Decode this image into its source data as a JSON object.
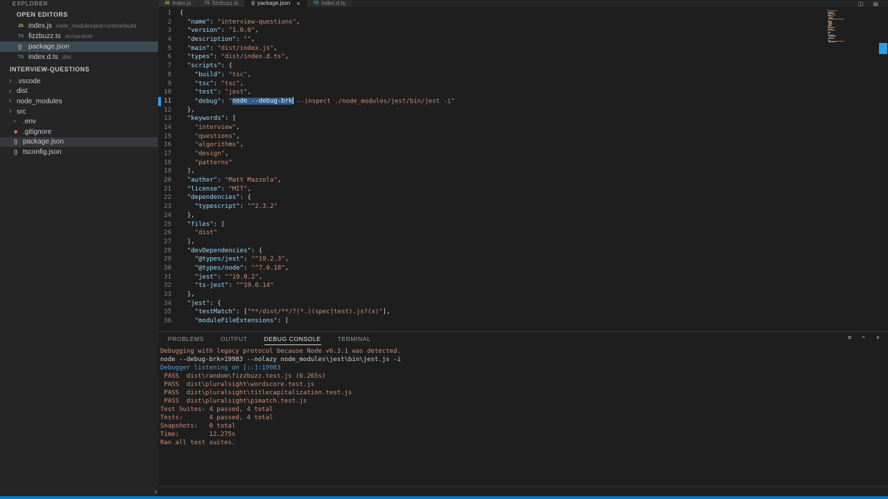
{
  "sidebar": {
    "title": "EXPLORER",
    "open_editors": {
      "title": "OPEN EDITORS",
      "items": [
        {
          "icon": "js",
          "name": "index.js",
          "path": "node_modules\\jest-runtime\\build",
          "selected": false
        },
        {
          "icon": "ts",
          "name": "fizzbuzz.ts",
          "path": "src\\random",
          "selected": false
        },
        {
          "icon": "json",
          "name": "package.json",
          "path": "",
          "selected": true
        },
        {
          "icon": "ts",
          "name": "index.d.ts",
          "path": "dist",
          "selected": false
        }
      ]
    },
    "tree": {
      "title": "INTERVIEW-QUESTIONS",
      "items": [
        {
          "kind": "folder",
          "name": ".vscode"
        },
        {
          "kind": "folder",
          "name": "dist"
        },
        {
          "kind": "folder",
          "name": "node_modules"
        },
        {
          "kind": "folder",
          "name": "src"
        },
        {
          "kind": "file",
          "icon": "env",
          "name": ".env"
        },
        {
          "kind": "file",
          "icon": "git",
          "name": ".gitignore"
        },
        {
          "kind": "file",
          "icon": "json",
          "name": "package.json",
          "selected": true
        },
        {
          "kind": "file",
          "icon": "json",
          "name": "tsconfig.json"
        }
      ]
    }
  },
  "tabs": [
    {
      "icon": "js",
      "label": "index.js",
      "active": false
    },
    {
      "icon": "ts",
      "label": "fizzbuzz.ts",
      "active": false
    },
    {
      "icon": "json",
      "label": "package.json",
      "active": true,
      "close": "×"
    },
    {
      "icon": "ts",
      "label": "index.d.ts",
      "active": false
    }
  ],
  "tabbar_actions": {
    "split_icon": "◫",
    "layout_icon": "▤"
  },
  "editor": {
    "selection_line": 11,
    "lines": [
      {
        "n": 1,
        "tokens": [
          [
            "p",
            "{"
          ]
        ]
      },
      {
        "n": 2,
        "tokens": [
          [
            "p",
            "  "
          ],
          [
            "k",
            "\"name\""
          ],
          [
            "p",
            ": "
          ],
          [
            "s",
            "\"interview-questions\""
          ],
          [
            "p",
            ","
          ]
        ]
      },
      {
        "n": 3,
        "tokens": [
          [
            "p",
            "  "
          ],
          [
            "k",
            "\"version\""
          ],
          [
            "p",
            ": "
          ],
          [
            "s",
            "\"1.0.0\""
          ],
          [
            "p",
            ","
          ]
        ]
      },
      {
        "n": 4,
        "tokens": [
          [
            "p",
            "  "
          ],
          [
            "k",
            "\"description\""
          ],
          [
            "p",
            ": "
          ],
          [
            "s",
            "\"\""
          ],
          [
            "p",
            ","
          ]
        ]
      },
      {
        "n": 5,
        "tokens": [
          [
            "p",
            "  "
          ],
          [
            "k",
            "\"main\""
          ],
          [
            "p",
            ": "
          ],
          [
            "s",
            "\"dist/index.js\""
          ],
          [
            "p",
            ","
          ]
        ]
      },
      {
        "n": 6,
        "tokens": [
          [
            "p",
            "  "
          ],
          [
            "k",
            "\"types\""
          ],
          [
            "p",
            ": "
          ],
          [
            "s",
            "\"dist/index.d.ts\""
          ],
          [
            "p",
            ","
          ]
        ]
      },
      {
        "n": 7,
        "tokens": [
          [
            "p",
            "  "
          ],
          [
            "k",
            "\"scripts\""
          ],
          [
            "p",
            ": {"
          ]
        ]
      },
      {
        "n": 8,
        "tokens": [
          [
            "p",
            "    "
          ],
          [
            "k",
            "\"build\""
          ],
          [
            "p",
            ": "
          ],
          [
            "s",
            "\"tsc\""
          ],
          [
            "p",
            ","
          ]
        ]
      },
      {
        "n": 9,
        "tokens": [
          [
            "p",
            "    "
          ],
          [
            "k",
            "\"tsc\""
          ],
          [
            "p",
            ": "
          ],
          [
            "s",
            "\"tsc\""
          ],
          [
            "p",
            ","
          ]
        ]
      },
      {
        "n": 10,
        "tokens": [
          [
            "p",
            "    "
          ],
          [
            "k",
            "\"test\""
          ],
          [
            "p",
            ": "
          ],
          [
            "s",
            "\"jest\""
          ],
          [
            "p",
            ","
          ]
        ]
      },
      {
        "n": 11,
        "tokens": [
          [
            "p",
            "    "
          ],
          [
            "k",
            "\"debug\""
          ],
          [
            "p",
            ": "
          ],
          [
            "s",
            "\""
          ],
          [
            "sel",
            "node --debug-brk"
          ],
          [
            "cur",
            ""
          ],
          [
            "s",
            " --inspect ./node_modules/jest/bin/jest -i\""
          ]
        ]
      },
      {
        "n": 12,
        "tokens": [
          [
            "p",
            "  },"
          ]
        ]
      },
      {
        "n": 13,
        "tokens": [
          [
            "p",
            "  "
          ],
          [
            "k",
            "\"keywords\""
          ],
          [
            "p",
            ": ["
          ]
        ]
      },
      {
        "n": 14,
        "tokens": [
          [
            "p",
            "    "
          ],
          [
            "s",
            "\"interview\""
          ],
          [
            "p",
            ","
          ]
        ]
      },
      {
        "n": 15,
        "tokens": [
          [
            "p",
            "    "
          ],
          [
            "s",
            "\"questions\""
          ],
          [
            "p",
            ","
          ]
        ]
      },
      {
        "n": 16,
        "tokens": [
          [
            "p",
            "    "
          ],
          [
            "s",
            "\"algorithms\""
          ],
          [
            "p",
            ","
          ]
        ]
      },
      {
        "n": 17,
        "tokens": [
          [
            "p",
            "    "
          ],
          [
            "s",
            "\"design\""
          ],
          [
            "p",
            ","
          ]
        ]
      },
      {
        "n": 18,
        "tokens": [
          [
            "p",
            "    "
          ],
          [
            "s",
            "\"patterns\""
          ]
        ]
      },
      {
        "n": 19,
        "tokens": [
          [
            "p",
            "  ],"
          ]
        ]
      },
      {
        "n": 20,
        "tokens": [
          [
            "p",
            "  "
          ],
          [
            "k",
            "\"author\""
          ],
          [
            "p",
            ": "
          ],
          [
            "s",
            "\"Matt Mazzola\""
          ],
          [
            "p",
            ","
          ]
        ]
      },
      {
        "n": 21,
        "tokens": [
          [
            "p",
            "  "
          ],
          [
            "k",
            "\"license\""
          ],
          [
            "p",
            ": "
          ],
          [
            "s",
            "\"MIT\""
          ],
          [
            "p",
            ","
          ]
        ]
      },
      {
        "n": 22,
        "tokens": [
          [
            "p",
            "  "
          ],
          [
            "k",
            "\"dependencies\""
          ],
          [
            "p",
            ": {"
          ]
        ]
      },
      {
        "n": 23,
        "tokens": [
          [
            "p",
            "    "
          ],
          [
            "k",
            "\"typescript\""
          ],
          [
            "p",
            ": "
          ],
          [
            "s",
            "\"^2.3.2\""
          ]
        ]
      },
      {
        "n": 24,
        "tokens": [
          [
            "p",
            "  },"
          ]
        ]
      },
      {
        "n": 25,
        "tokens": [
          [
            "p",
            "  "
          ],
          [
            "k",
            "\"files\""
          ],
          [
            "p",
            ": ["
          ]
        ]
      },
      {
        "n": 26,
        "tokens": [
          [
            "p",
            "    "
          ],
          [
            "s",
            "\"dist\""
          ]
        ]
      },
      {
        "n": 27,
        "tokens": [
          [
            "p",
            "  ],"
          ]
        ]
      },
      {
        "n": 28,
        "tokens": [
          [
            "p",
            "  "
          ],
          [
            "k",
            "\"devDependencies\""
          ],
          [
            "p",
            ": {"
          ]
        ]
      },
      {
        "n": 29,
        "tokens": [
          [
            "p",
            "    "
          ],
          [
            "k",
            "\"@types/jest\""
          ],
          [
            "p",
            ": "
          ],
          [
            "s",
            "\"^19.2.3\""
          ],
          [
            "p",
            ","
          ]
        ]
      },
      {
        "n": 30,
        "tokens": [
          [
            "p",
            "    "
          ],
          [
            "k",
            "\"@types/node\""
          ],
          [
            "p",
            ": "
          ],
          [
            "s",
            "\"^7.0.18\""
          ],
          [
            "p",
            ","
          ]
        ]
      },
      {
        "n": 31,
        "tokens": [
          [
            "p",
            "    "
          ],
          [
            "k",
            "\"jest\""
          ],
          [
            "p",
            ": "
          ],
          [
            "s",
            "\"^19.0.2\""
          ],
          [
            "p",
            ","
          ]
        ]
      },
      {
        "n": 32,
        "tokens": [
          [
            "p",
            "    "
          ],
          [
            "k",
            "\"ts-jest\""
          ],
          [
            "p",
            ": "
          ],
          [
            "s",
            "\"^19.0.14\""
          ]
        ]
      },
      {
        "n": 33,
        "tokens": [
          [
            "p",
            "  },"
          ]
        ]
      },
      {
        "n": 34,
        "tokens": [
          [
            "p",
            "  "
          ],
          [
            "k",
            "\"jest\""
          ],
          [
            "p",
            ": {"
          ]
        ]
      },
      {
        "n": 35,
        "tokens": [
          [
            "p",
            "    "
          ],
          [
            "k",
            "\"testMatch\""
          ],
          [
            "p",
            ": ["
          ],
          [
            "s",
            "\"**/dist/**/?(*.)(spec|test).js?(x)\""
          ],
          [
            "p",
            "],"
          ]
        ]
      },
      {
        "n": 36,
        "tokens": [
          [
            "p",
            "    "
          ],
          [
            "k",
            "\"moduleFileExtensions\""
          ],
          [
            "p",
            ": ["
          ]
        ]
      }
    ]
  },
  "panel": {
    "tabs": [
      {
        "label": "PROBLEMS",
        "active": false
      },
      {
        "label": "OUTPUT",
        "active": false
      },
      {
        "label": "DEBUG CONSOLE",
        "active": true
      },
      {
        "label": "TERMINAL",
        "active": false
      }
    ],
    "actions": {
      "clear_icon": "≡",
      "collapse_icon": "›",
      "close_icon": "×"
    },
    "console": [
      {
        "color": "tan",
        "text": "Debugging with legacy protocol because Node v6.3.1 was detected."
      },
      {
        "color": "gray",
        "text": "node --debug-brk=19983 --nolazy node_modules\\jest\\bin\\jest.js -i"
      },
      {
        "color": "blue",
        "text": "Debugger listening on [::]:19983"
      },
      {
        "color": "tan",
        "text": " PASS  dist\\random\\fizzbuzz.test.js (6.265s)"
      },
      {
        "color": "tan",
        "text": " PASS  dist\\pluralsight\\wordscore.test.js"
      },
      {
        "color": "tan",
        "text": " PASS  dist\\pluralsight\\titlecapitalization.test.js"
      },
      {
        "color": "tan",
        "text": " PASS  dist\\pluralsight\\pimatch.test.js"
      },
      {
        "color": "tan",
        "text": "Test Suites: 4 passed, 4 total"
      },
      {
        "color": "tan",
        "text": "Tests:       4 passed, 4 total"
      },
      {
        "color": "tan",
        "text": "Snapshots:   0 total"
      },
      {
        "color": "tan",
        "text": "Time:        12.275s"
      },
      {
        "color": "tan",
        "text": "Ran all test suites."
      }
    ],
    "prompt": "›"
  },
  "statusbar": {
    "color": "#007acc"
  }
}
